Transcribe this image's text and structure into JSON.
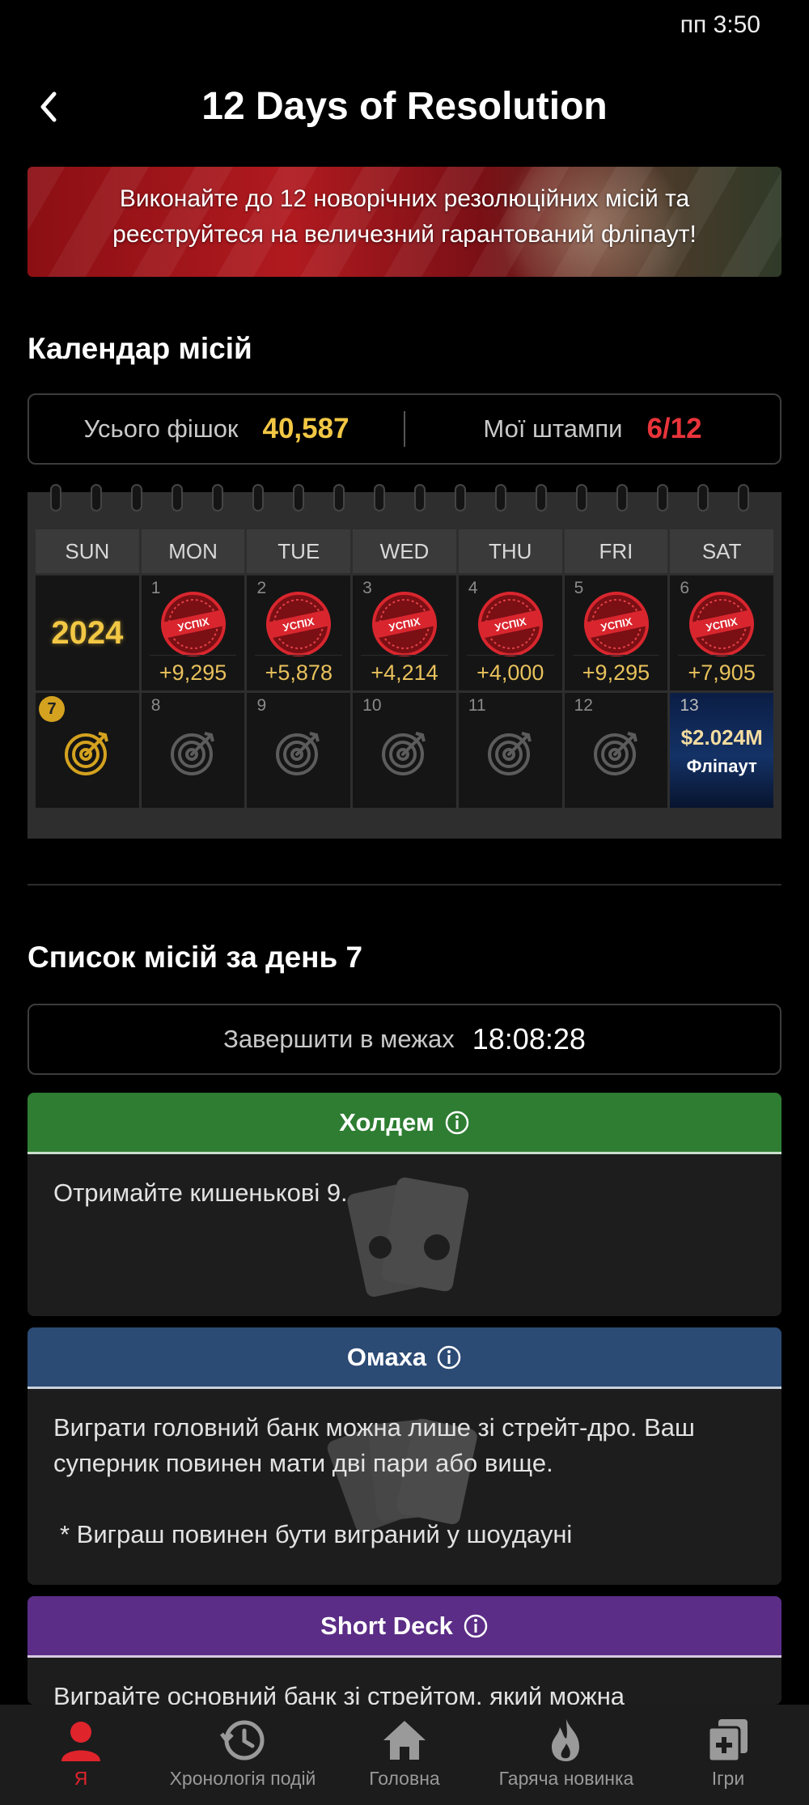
{
  "status_bar": {
    "time": "пп 3:50"
  },
  "header": {
    "title": "12 Days of Resolution"
  },
  "banner": {
    "line1": "Виконайте до 12 новорічних резолюційних місій та",
    "line2": "реєструйтеся на величезний гарантований фліпаут!"
  },
  "calendar_section": {
    "title": "Календар місій"
  },
  "stats": {
    "chips_label": "Усього фішок",
    "chips_value": "40,587",
    "stamps_label": "Мої штампи",
    "stamps_value": "6/12",
    "chips_color": "#f2c744",
    "stamps_color": "#e8343a"
  },
  "calendar": {
    "weekdays": [
      "SUN",
      "MON",
      "TUE",
      "WED",
      "THU",
      "FRI",
      "SAT"
    ],
    "year": "2024",
    "stamp_text": "УСПІХ",
    "week1": [
      {
        "day": "1",
        "chips": "+9,295"
      },
      {
        "day": "2",
        "chips": "+5,878"
      },
      {
        "day": "3",
        "chips": "+4,214"
      },
      {
        "day": "4",
        "chips": "+4,000"
      },
      {
        "day": "5",
        "chips": "+9,295"
      },
      {
        "day": "6",
        "chips": "+7,905"
      }
    ],
    "week2": [
      {
        "day": "7",
        "today": true
      },
      {
        "day": "8"
      },
      {
        "day": "9"
      },
      {
        "day": "10"
      },
      {
        "day": "11"
      },
      {
        "day": "12"
      }
    ],
    "flipout": {
      "day": "13",
      "amount": "$2.024M",
      "label": "Фліпаут"
    }
  },
  "missions_section": {
    "title": "Список місій за день 7"
  },
  "timer": {
    "label": "Завершити в межах",
    "value": "18:08:28"
  },
  "missions": [
    {
      "name": "Холдем",
      "color": "#2e7d32",
      "text": "Отримайте кишенькові 9."
    },
    {
      "name": "Омаха",
      "color": "#2b4a74",
      "text": "Виграти головний банк можна лише зі стрейт-дро. Ваш суперник повинен мати дві пари або вище.",
      "note": "* Виграш повинен бути виграний у шоудауні"
    },
    {
      "name": "Short Deck",
      "color": "#5b2d86",
      "text": "Виграйте основний банк зі стрейтом, який можна"
    }
  ],
  "bottom_nav": {
    "items": [
      {
        "label": "Я",
        "icon": "profile-icon"
      },
      {
        "label": "Хронологія подій",
        "icon": "history-icon"
      },
      {
        "label": "Головна",
        "icon": "home-icon"
      },
      {
        "label": "Гаряча новинка",
        "icon": "fire-icon"
      },
      {
        "label": "Ігри",
        "icon": "games-icon"
      }
    ],
    "active_color": "#e0242c"
  }
}
